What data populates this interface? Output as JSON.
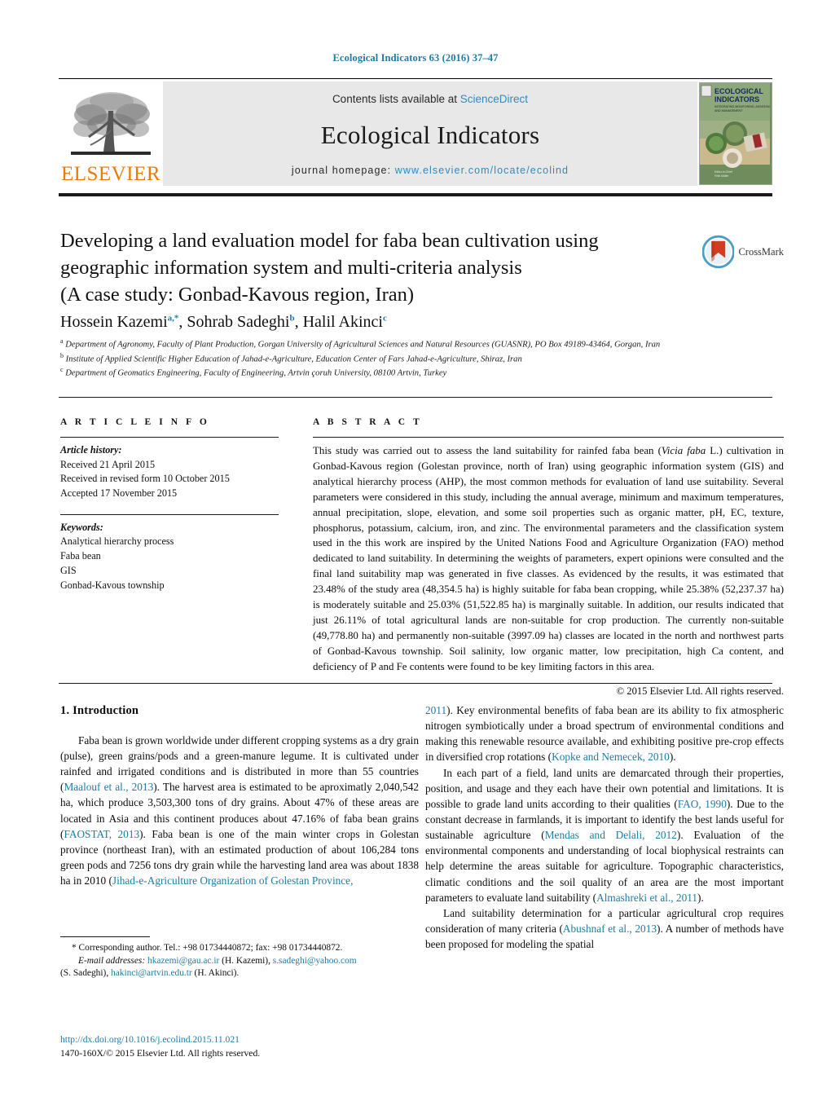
{
  "running_head": "Ecological Indicators 63 (2016) 37–47",
  "banner": {
    "publisher": "ELSEVIER",
    "contents_prefix": "Contents lists available at ",
    "contents_link": "ScienceDirect",
    "journal_name": "Ecological Indicators",
    "homepage_prefix": "journal homepage: ",
    "homepage_url": "www.elsevier.com/locate/ecolind",
    "cover_title_line1": "ECOLOGICAL",
    "cover_title_line2": "INDICATORS",
    "cover_subtitle": "INTEGRATING MONITORING, ASSESSMENT AND MANAGEMENT"
  },
  "crossmark": {
    "label": "CrossMark"
  },
  "article": {
    "title_line1": "Developing a land evaluation model for faba bean cultivation using",
    "title_line2": "geographic information system and multi-criteria analysis",
    "title_line3": "(A case study: Gonbad-Kavous region, Iran)",
    "authors": [
      {
        "name": "Hossein Kazemi",
        "marks": "a,*"
      },
      {
        "name": "Sohrab Sadeghi",
        "marks": "b"
      },
      {
        "name": "Halil Akinci",
        "marks": "c"
      }
    ],
    "affiliations": [
      {
        "mark": "a",
        "text": "Department of Agronomy, Faculty of Plant Production, Gorgan University of Agricultural Sciences and Natural Resources (GUASNR), PO Box 49189-43464, Gorgan, Iran"
      },
      {
        "mark": "b",
        "text": "Institute of Applied Scientific Higher Education of Jahad-e-Agriculture, Education Center of Fars Jahad-e-Agriculture, Shiraz, Iran"
      },
      {
        "mark": "c",
        "text": "Department of Geomatics Engineering, Faculty of Engineering, Artvin çoruh University, 08100 Artvin, Turkey"
      }
    ]
  },
  "article_info": {
    "heading": "A R T I C L E    I N F O",
    "history_label": "Article history:",
    "history": [
      "Received 21 April 2015",
      "Received in revised form 10 October 2015",
      "Accepted 17 November 2015"
    ],
    "keywords_label": "Keywords:",
    "keywords": [
      "Analytical hierarchy process",
      "Faba bean",
      "GIS",
      "Gonbad-Kavous township"
    ]
  },
  "abstract": {
    "heading": "A B S T R A C T",
    "text_part1": "This study was carried out to assess the land suitability for rainfed faba bean (",
    "species": "Vicia faba",
    "text_part2": " L.) cultivation in Gonbad-Kavous region (Golestan province, north of Iran) using geographic information system (GIS) and analytical hierarchy process (AHP), the most common methods for evaluation of land use suitability. Several parameters were considered in this study, including the annual average, minimum and maximum temperatures, annual precipitation, slope, elevation, and some soil properties such as organic matter, pH, EC, texture, phosphorus, potassium, calcium, iron, and zinc. The environmental parameters and the classification system used in the this work are inspired by the United Nations Food and Agriculture Organization (FAO) method dedicated to land suitability. In determining the weights of parameters, expert opinions were consulted and the final land suitability map was generated in five classes. As evidenced by the results, it was estimated that 23.48% of the study area (48,354.5 ha) is highly suitable for faba bean cropping, while 25.38% (52,237.37 ha) is moderately suitable and 25.03% (51,522.85 ha) is marginally suitable. In addition, our results indicated that just 26.11% of total agricultural lands are non-suitable for crop production. The currently non-suitable (49,778.80 ha) and permanently non-suitable (3997.09 ha) classes are located in the north and northwest parts of Gonbad-Kavous township. Soil salinity, low organic matter, low precipitation, high Ca content, and deficiency of P and Fe contents were found to be key limiting factors in this area.",
    "copyright": "© 2015 Elsevier Ltd. All rights reserved."
  },
  "body": {
    "section_heading": "1.  Introduction",
    "left_p1_a": "Faba bean is grown worldwide under different cropping systems as a dry grain (pulse), green grains/pods and a green-manure legume. It is cultivated under rainfed and irrigated conditions and is distributed in more than 55 countries (",
    "left_p1_ref1": "Maalouf et al., 2013",
    "left_p1_b": "). The harvest area is estimated to be aproximatly 2,040,542 ha, which produce 3,503,300 tons of dry grains. About 47% of these areas are located in Asia and this continent produces about 47.16% of faba bean grains (",
    "left_p1_ref2": "FAOSTAT, 2013",
    "left_p1_c": "). Faba bean is one of the main winter crops in Golestan province (northeast Iran), with an estimated production of about 106,284 tons green pods and 7256 tons dry grain while the harvesting land area was about 1838 ha in 2010 (",
    "left_p1_ref3": "Jihad-e-Agriculture Organization of Golestan Province,",
    "right_p1_ref_cont": "2011",
    "right_p1_a": "). Key environmental benefits of faba bean are its ability to fix atmospheric nitrogen symbiotically under a broad spectrum of environmental conditions and making this renewable resource available, and exhibiting positive pre-crop effects in diversified crop rotations (",
    "right_p1_ref1": "Kopke and Nemecek, 2010",
    "right_p1_b": ").",
    "right_p2_a": "In each part of a field, land units are demarcated through their properties, position, and usage and they each have their own potential and limitations. It is possible to grade land units according to their qualities (",
    "right_p2_ref1": "FAO, 1990",
    "right_p2_b": "). Due to the constant decrease in farmlands, it is important to identify the best lands useful for sustainable agriculture (",
    "right_p2_ref2": "Mendas and Delali, 2012",
    "right_p2_c": "). Evaluation of the environmental components and understanding of local biophysical restraints can help determine the areas suitable for agriculture. Topographic characteristics, climatic conditions and the soil quality of an area are the most important parameters to evaluate land suitability (",
    "right_p2_ref3": "Almashreki et al., 2011",
    "right_p2_d": ").",
    "right_p3_a": "Land suitability determination for a particular agricultural crop requires consideration of many criteria (",
    "right_p3_ref1": "Abushnaf et al., 2013",
    "right_p3_b": "). A number of methods have been proposed for modeling the spatial"
  },
  "footnotes": {
    "corresponding": "* Corresponding author. Tel.: +98 01734440872; fax: +98 01734440872.",
    "email_label": "E-mail addresses:",
    "email1": "hkazemi@gau.ac.ir",
    "email1_owner": " (H. Kazemi), ",
    "email2": "s.sadeghi@yahoo.com",
    "email2_owner": "(S. Sadeghi), ",
    "email3": "hakinci@artvin.edu.tr",
    "email3_owner": " (H. Akinci)."
  },
  "footer": {
    "doi": "http://dx.doi.org/10.1016/j.ecolind.2015.11.021",
    "issn": "1470-160X/© 2015 Elsevier Ltd. All rights reserved."
  },
  "colors": {
    "link": "#1f7ba6",
    "elsevier_orange": "#ec7a08",
    "banner_bg": "#e8e8e8"
  }
}
